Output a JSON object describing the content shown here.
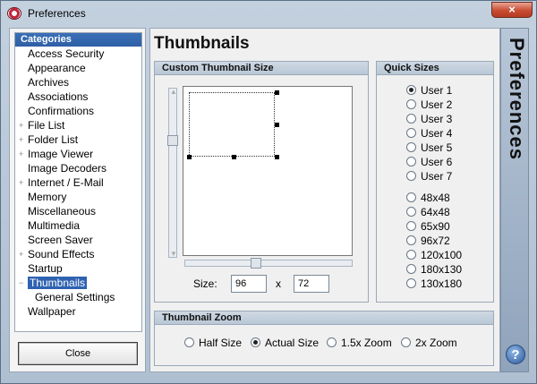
{
  "window": {
    "title": "Preferences",
    "close_glyph": "×",
    "side_banner": "Preferences",
    "help_glyph": "?"
  },
  "categories": {
    "header": "Categories",
    "items": [
      {
        "label": "Access Security",
        "expandable": false
      },
      {
        "label": "Appearance",
        "expandable": false
      },
      {
        "label": "Archives",
        "expandable": false
      },
      {
        "label": "Associations",
        "expandable": false
      },
      {
        "label": "Confirmations",
        "expandable": false
      },
      {
        "label": "File List",
        "expandable": true
      },
      {
        "label": "Folder List",
        "expandable": true
      },
      {
        "label": "Image Viewer",
        "expandable": true
      },
      {
        "label": "Image Decoders",
        "expandable": false
      },
      {
        "label": "Internet / E-Mail",
        "expandable": true
      },
      {
        "label": "Memory",
        "expandable": false
      },
      {
        "label": "Miscellaneous",
        "expandable": false
      },
      {
        "label": "Multimedia",
        "expandable": false
      },
      {
        "label": "Screen Saver",
        "expandable": false
      },
      {
        "label": "Sound Effects",
        "expandable": true
      },
      {
        "label": "Startup",
        "expandable": false
      },
      {
        "label": "Thumbnails",
        "expandable": true,
        "expanded": true,
        "selected": true
      },
      {
        "label": "General Settings",
        "sub": true
      },
      {
        "label": "Wallpaper",
        "expandable": false
      }
    ],
    "close_button": "Close"
  },
  "page": {
    "title": "Thumbnails",
    "custom_size_group": "Custom Thumbnail Size",
    "size_label": "Size:",
    "width_value": "96",
    "x_sep": "x",
    "height_value": "72",
    "quick_sizes_group": "Quick Sizes",
    "quick_sizes": [
      "User 1",
      "User 2",
      "User 3",
      "User 4",
      "User 5",
      "User 6",
      "User 7",
      "48x48",
      "64x48",
      "65x90",
      "96x72",
      "120x100",
      "180x130",
      "130x180"
    ],
    "quick_sizes_selected": "User 1",
    "zoom_group": "Thumbnail Zoom",
    "zoom_options": [
      "Half Size",
      "Actual Size",
      "1.5x Zoom",
      "2x Zoom"
    ],
    "zoom_selected": "Actual Size"
  },
  "colors": {
    "selection": "#2f62b1",
    "header_blue": "#3a70b8",
    "close_red": "#c94c32"
  }
}
